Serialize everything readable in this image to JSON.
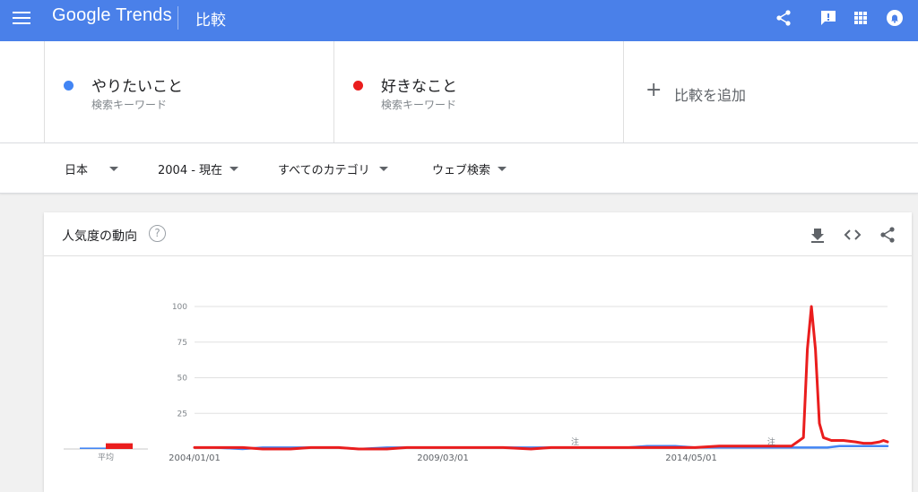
{
  "header": {
    "logo": "Google Trends",
    "page_title": "比較",
    "icons": [
      "menu-icon",
      "share-icon",
      "feedback-icon",
      "apps-icon",
      "notifications-icon"
    ]
  },
  "terms": [
    {
      "name": "やりたいこと",
      "type": "検索キーワード",
      "color": "#4285f4"
    },
    {
      "name": "好きなこと",
      "type": "検索キーワード",
      "color": "#ea1d1d"
    }
  ],
  "add_compare": {
    "icon": "plus-icon",
    "label": "比較を追加"
  },
  "filters": {
    "region": "日本",
    "period": "2004 - 現在",
    "category": "すべてのカテゴリ",
    "search_type": "ウェブ検索"
  },
  "card": {
    "title": "人気度の動向",
    "icons": [
      "help-icon",
      "download-icon",
      "embed-icon",
      "share-icon"
    ]
  },
  "chart_data": {
    "type": "line",
    "y_ticks": [
      "25",
      "50",
      "75",
      "100"
    ],
    "ylim": [
      0,
      100
    ],
    "x_tick_labels": [
      "2004/01/01",
      "2009/03/01",
      "2014/05/01"
    ],
    "average_label": "平均",
    "averages": [
      {
        "term": "やりたいこと",
        "value": 1
      },
      {
        "term": "好きなこと",
        "value": 4
      }
    ],
    "notes": [
      {
        "label": "注",
        "date": "2011/12"
      },
      {
        "label": "注",
        "date": "2016/01"
      }
    ],
    "x_range": [
      "2004/01",
      "2018/06"
    ],
    "series": [
      {
        "name": "やりたいこと",
        "color": "#4285f4",
        "points": [
          [
            "2004/01",
            1
          ],
          [
            "2004/06",
            1
          ],
          [
            "2005/01",
            0
          ],
          [
            "2005/06",
            1
          ],
          [
            "2006/01",
            1
          ],
          [
            "2006/06",
            1
          ],
          [
            "2007/01",
            1
          ],
          [
            "2007/06",
            0
          ],
          [
            "2008/01",
            1
          ],
          [
            "2008/06",
            1
          ],
          [
            "2009/01",
            1
          ],
          [
            "2009/06",
            1
          ],
          [
            "2010/01",
            1
          ],
          [
            "2010/06",
            1
          ],
          [
            "2011/01",
            1
          ],
          [
            "2011/06",
            1
          ],
          [
            "2012/01",
            1
          ],
          [
            "2012/06",
            1
          ],
          [
            "2013/01",
            1
          ],
          [
            "2013/06",
            2
          ],
          [
            "2014/01",
            2
          ],
          [
            "2014/06",
            1
          ],
          [
            "2015/01",
            1
          ],
          [
            "2015/06",
            1
          ],
          [
            "2016/01",
            1
          ],
          [
            "2016/06",
            1
          ],
          [
            "2016/10",
            1
          ],
          [
            "2017/01",
            1
          ],
          [
            "2017/03",
            1
          ],
          [
            "2017/06",
            2
          ],
          [
            "2017/08",
            2
          ],
          [
            "2017/11",
            2
          ],
          [
            "2018/02",
            2
          ],
          [
            "2018/06",
            2
          ]
        ]
      },
      {
        "name": "好きなこと",
        "color": "#ea1d1d",
        "points": [
          [
            "2004/01",
            1
          ],
          [
            "2004/06",
            1
          ],
          [
            "2005/01",
            1
          ],
          [
            "2005/06",
            0
          ],
          [
            "2006/01",
            0
          ],
          [
            "2006/06",
            1
          ],
          [
            "2007/01",
            1
          ],
          [
            "2007/06",
            0
          ],
          [
            "2008/01",
            0
          ],
          [
            "2008/06",
            1
          ],
          [
            "2009/01",
            1
          ],
          [
            "2009/06",
            1
          ],
          [
            "2010/01",
            1
          ],
          [
            "2010/06",
            1
          ],
          [
            "2011/01",
            0
          ],
          [
            "2011/06",
            1
          ],
          [
            "2012/01",
            1
          ],
          [
            "2012/06",
            1
          ],
          [
            "2013/01",
            1
          ],
          [
            "2013/06",
            1
          ],
          [
            "2014/01",
            1
          ],
          [
            "2014/06",
            1
          ],
          [
            "2014/12",
            2
          ],
          [
            "2015/06",
            2
          ],
          [
            "2016/01",
            2
          ],
          [
            "2016/06",
            2
          ],
          [
            "2016/09",
            8
          ],
          [
            "2016/10",
            70
          ],
          [
            "2016/11",
            100
          ],
          [
            "2016/12",
            70
          ],
          [
            "2017/01",
            18
          ],
          [
            "2017/02",
            8
          ],
          [
            "2017/04",
            6
          ],
          [
            "2017/07",
            6
          ],
          [
            "2017/10",
            5
          ],
          [
            "2017/12",
            4
          ],
          [
            "2018/02",
            4
          ],
          [
            "2018/04",
            5
          ],
          [
            "2018/05",
            6
          ],
          [
            "2018/06",
            5
          ]
        ]
      }
    ]
  }
}
